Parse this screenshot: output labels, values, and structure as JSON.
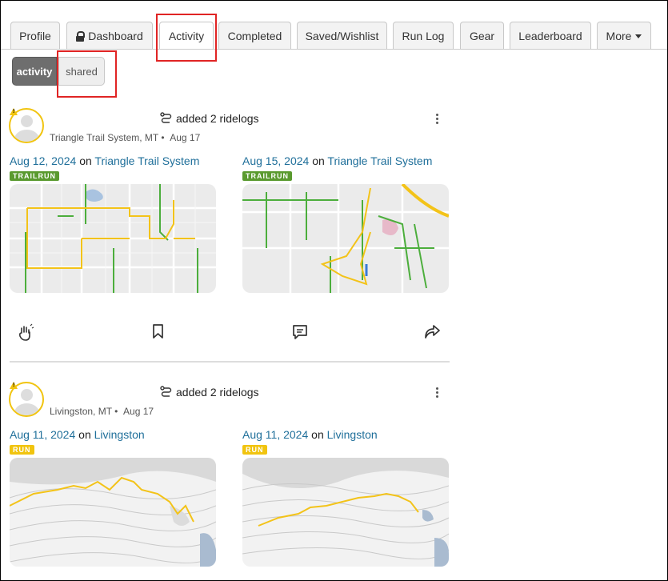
{
  "tabs": [
    {
      "label": "Profile"
    },
    {
      "label": "Dashboard",
      "icon": "lock-icon"
    },
    {
      "label": "Activity",
      "active": true
    },
    {
      "label": "Completed"
    },
    {
      "label": "Saved/Wishlist"
    },
    {
      "label": "Run Log"
    },
    {
      "label": "Gear"
    },
    {
      "label": "Leaderboard"
    },
    {
      "label": "More",
      "icon": "caret-down-icon"
    }
  ],
  "subtabs": {
    "activity": "activity",
    "shared": "shared"
  },
  "colors": {
    "link": "#1f6f9a",
    "trailrun_badge": "#5a9a2f",
    "run_badge": "#f1c40f",
    "highlight": "#e02424",
    "avatar_ring": "#f1c40f"
  },
  "feed": [
    {
      "action": "added 2 ridelogs",
      "location": "Triangle Trail System, MT",
      "date": "Aug 17",
      "entries": [
        {
          "date": "Aug 12, 2024",
          "on": "on",
          "trail": "Triangle Trail System",
          "badge": "TRAILRUN",
          "map": "city"
        },
        {
          "date": "Aug 15, 2024",
          "on": "on",
          "trail": "Triangle Trail System",
          "badge": "TRAILRUN",
          "map": "city2"
        }
      ],
      "footer_icons": [
        "high-five-icon",
        "bookmark-icon",
        "comment-icon",
        "share-icon"
      ]
    },
    {
      "action": "added 2 ridelogs",
      "location": "Livingston, MT",
      "date": "Aug 17",
      "entries": [
        {
          "date": "Aug 11, 2024",
          "on": "on",
          "trail": "Livingston",
          "badge": "RUN",
          "map": "topo"
        },
        {
          "date": "Aug 11, 2024",
          "on": "on",
          "trail": "Livingston",
          "badge": "RUN",
          "map": "topo"
        }
      ]
    }
  ]
}
